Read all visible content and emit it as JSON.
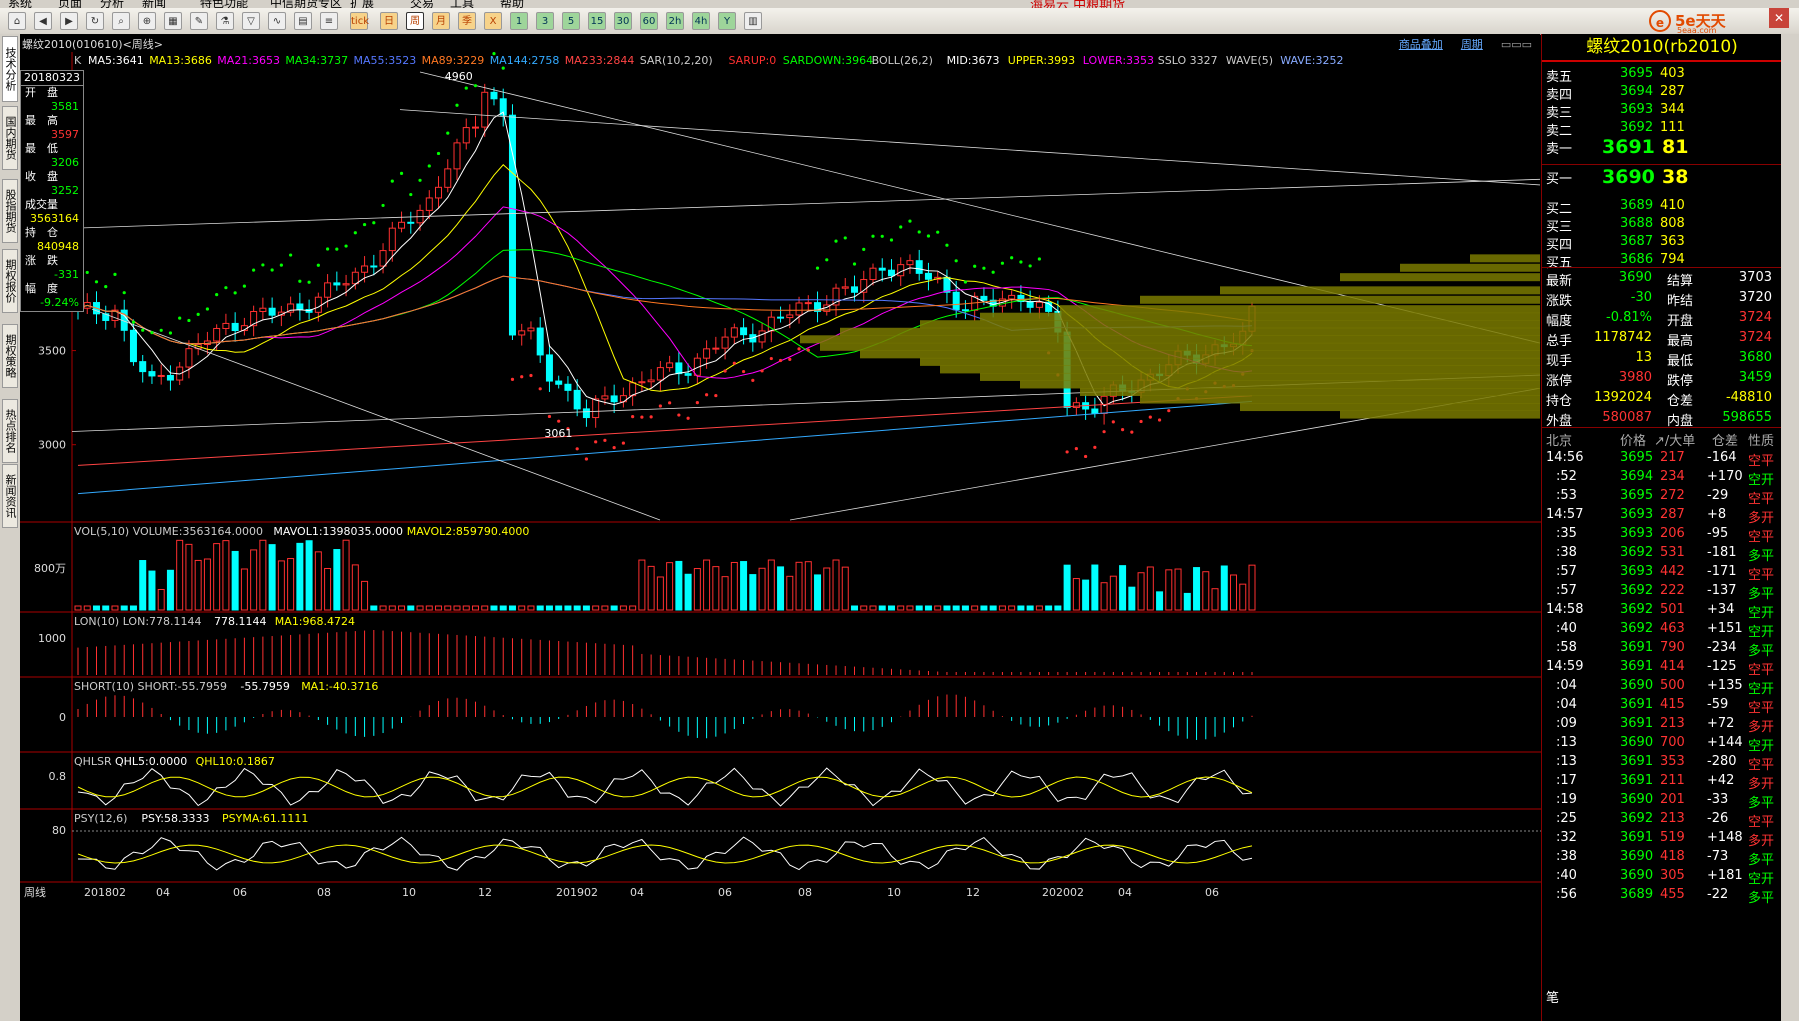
{
  "menu": [
    "系统",
    "页面",
    "分析",
    "新闻",
    "特色功能",
    "中信期货专区",
    "扩展",
    "交易",
    "工具",
    "帮助"
  ],
  "center_title": "海易云 中粮期货",
  "toolbar_icons": [
    "home-icon",
    "back-icon",
    "forward-icon",
    "refresh-icon",
    "search-icon",
    "zoom-icon",
    "chart-icon",
    "draw-icon",
    "lab-icon",
    "filter-icon",
    "indicator-icon",
    "grid-icon",
    "list-icon",
    "tick",
    "日",
    "周",
    "月",
    "季",
    "X",
    "1",
    "3",
    "5",
    "15",
    "30",
    "60",
    "2h",
    "4h",
    "Y",
    "calendar-icon"
  ],
  "brand": {
    "logo": "e",
    "text": "5e天天",
    "sub": "5eaa.com"
  },
  "left_tabs": [
    "技术分析",
    "国内期货",
    "股指期货",
    "期权报价",
    "期权策略",
    "热点排名",
    "新闻资讯"
  ],
  "chart": {
    "title": "螺纹2010(010610)<周线>",
    "links": [
      "商品叠加",
      "周期"
    ],
    "main_label": "K",
    "main_indicators": [
      {
        "t": "MA5:3641",
        "c": "#ffffff"
      },
      {
        "t": "MA13:3686",
        "c": "#ffff00"
      },
      {
        "t": "MA21:3653",
        "c": "#ff00ff"
      },
      {
        "t": "MA34:3737",
        "c": "#00ff00"
      },
      {
        "t": "MA55:3523",
        "c": "#5577ff"
      },
      {
        "t": "MA89:3229",
        "c": "#ff7722"
      },
      {
        "t": "MA144:2758",
        "c": "#33aaff"
      },
      {
        "t": "MA233:2844",
        "c": "#ff4444"
      },
      {
        "t": "SAR(10,2,20)",
        "c": "#cccccc"
      },
      {
        "t": "SARUP:0",
        "c": "#ff3030"
      },
      {
        "t": "SARDOWN:3964",
        "c": "#00ff00"
      },
      {
        "t": "BOLL(26,2)",
        "c": "#cccccc"
      },
      {
        "t": "MID:3673",
        "c": "#ffffff"
      },
      {
        "t": "UPPER:3993",
        "c": "#ffff00"
      },
      {
        "t": "LOWER:3353",
        "c": "#ff00ff"
      },
      {
        "t": "SSLO 3327",
        "c": "#cccccc"
      },
      {
        "t": "WAVE(5)",
        "c": "#cccccc"
      },
      {
        "t": "WAVE:3252",
        "c": "#88aaff"
      }
    ],
    "price_ticks": [
      "3500",
      "3000"
    ],
    "annot_high": "4960",
    "annot_low": "3061",
    "vol_label": "VOL(5,10) VOLUME:3563164.0000",
    "vol_mavol1": "MAVOL1:1398035.0000",
    "vol_mavol2": "MAVOL2:859790.4000",
    "vol_tick": "800万",
    "lon_label": "LON(10) LON:778.1144",
    "lon_val": "778.1144",
    "lon_ma": "MA1:968.4724",
    "lon_tick": "1000",
    "short_label": "SHORT(10) SHORT:-55.7959",
    "short_val": "-55.7959",
    "short_ma": "MA1:-40.3716",
    "short_tick": "0",
    "qhl_label": "QHLSR",
    "qhl5": "QHL5:0.0000",
    "qhl10": "QHL10:0.1867",
    "qhl_tick": "0.8",
    "psy_label": "PSY(12,6)",
    "psy": "PSY:58.3333",
    "psyma": "PSYMA:61.1111",
    "psy_tick": "80",
    "x_axis": [
      "周线",
      "201802",
      "04",
      "06",
      "08",
      "10",
      "12",
      "201902",
      "04",
      "06",
      "08",
      "10",
      "12",
      "202002",
      "04",
      "06"
    ]
  },
  "infobox": {
    "date": "20180323",
    "open_label": "开　盘",
    "open": "3581",
    "high_label": "最　高",
    "high": "3597",
    "low_label": "最　低",
    "low": "3206",
    "close_label": "收　盘",
    "close": "3252",
    "vol_label": "成交量",
    "vol": "3563164",
    "oi_label": "持　仓",
    "oi": "840948",
    "chg_label": "涨　跌",
    "chg": "-331",
    "amp_label": "幅　度",
    "amp": "-9.24%"
  },
  "quote": {
    "title": "螺纹2010(rb2010)",
    "asks": [
      [
        "卖五",
        "3695",
        "403"
      ],
      [
        "卖四",
        "3694",
        "287"
      ],
      [
        "卖三",
        "3693",
        "344"
      ],
      [
        "卖二",
        "3692",
        "111"
      ],
      [
        "卖一",
        "3691",
        "81"
      ]
    ],
    "bids": [
      [
        "买一",
        "3690",
        "38"
      ],
      [
        "买二",
        "3689",
        "410"
      ],
      [
        "买三",
        "3688",
        "808"
      ],
      [
        "买四",
        "3687",
        "363"
      ],
      [
        "买五",
        "3686",
        "794"
      ]
    ],
    "stats": [
      [
        "最新",
        "3690",
        "结算",
        "3703"
      ],
      [
        "涨跌",
        "-30",
        "昨结",
        "3720"
      ],
      [
        "幅度",
        "-0.81%",
        "开盘",
        "3724"
      ],
      [
        "总手",
        "1178742",
        "最高",
        "3724"
      ],
      [
        "现手",
        "13",
        "最低",
        "3680"
      ],
      [
        "涨停",
        "3980",
        "跌停",
        "3459"
      ],
      [
        "持仓",
        "1392024",
        "仓差",
        "-48810"
      ],
      [
        "外盘",
        "580087",
        "内盘",
        "598655"
      ]
    ],
    "tick_header": [
      "北京",
      "价格",
      "↗/大单",
      "仓差",
      "性质"
    ],
    "ticks": [
      [
        "14:56",
        "3695",
        "217",
        "-164",
        "空平"
      ],
      [
        ":52",
        "3694",
        "234",
        "+170",
        "空开"
      ],
      [
        ":53",
        "3695",
        "272",
        "-29",
        "空平"
      ],
      [
        "14:57",
        "3693",
        "287",
        "+8",
        "多开"
      ],
      [
        ":35",
        "3693",
        "206",
        "-95",
        "空平"
      ],
      [
        ":38",
        "3692",
        "531",
        "-181",
        "多平"
      ],
      [
        ":57",
        "3693",
        "442",
        "-171",
        "空平"
      ],
      [
        ":57",
        "3692",
        "222",
        "-137",
        "多平"
      ],
      [
        "14:58",
        "3692",
        "501",
        "+34",
        "空开"
      ],
      [
        ":40",
        "3692",
        "463",
        "+151",
        "空开"
      ],
      [
        ":58",
        "3691",
        "790",
        "-234",
        "多平"
      ],
      [
        "14:59",
        "3691",
        "414",
        "-125",
        "空平"
      ],
      [
        ":04",
        "3690",
        "500",
        "+135",
        "空开"
      ],
      [
        ":04",
        "3691",
        "415",
        "-59",
        "空平"
      ],
      [
        ":09",
        "3691",
        "213",
        "+72",
        "多开"
      ],
      [
        ":13",
        "3690",
        "700",
        "+144",
        "空开"
      ],
      [
        ":13",
        "3691",
        "353",
        "-280",
        "空平"
      ],
      [
        ":17",
        "3691",
        "211",
        "+42",
        "多开"
      ],
      [
        ":19",
        "3690",
        "201",
        "-33",
        "多平"
      ],
      [
        ":25",
        "3692",
        "213",
        "-26",
        "空平"
      ],
      [
        ":32",
        "3691",
        "519",
        "+148",
        "多开"
      ],
      [
        ":38",
        "3690",
        "418",
        "-73",
        "多平"
      ],
      [
        ":40",
        "3690",
        "305",
        "+181",
        "空开"
      ],
      [
        ":56",
        "3689",
        "455",
        "-22",
        "多平"
      ]
    ],
    "footer": "笔"
  }
}
